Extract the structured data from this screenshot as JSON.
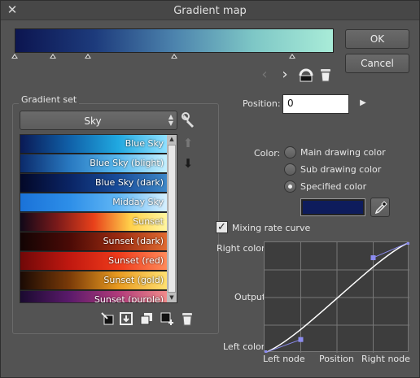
{
  "window": {
    "title": "Gradient map",
    "close_glyph": "✕"
  },
  "buttons": {
    "ok": "OK",
    "cancel": "Cancel"
  },
  "preview": {
    "gradient_colors": [
      "#0c1550",
      "#1d3b7c",
      "#4c83ad",
      "#7ec7c6",
      "#a9ecd8"
    ],
    "marker_positions": [
      0.0,
      0.12,
      0.23,
      0.5,
      0.87
    ]
  },
  "nav": {
    "prev": "‹",
    "next": "›"
  },
  "gradient_set": {
    "title": "Gradient set",
    "selected": "Sky",
    "items": [
      {
        "label": "Blue Sky",
        "colors": [
          "#0a1a55",
          "#1060a8",
          "#20a8e0",
          "#8fe0ff"
        ]
      },
      {
        "label": "Blue Sky (blight)",
        "colors": [
          "#0b2a6a",
          "#2878c0",
          "#58b8ee",
          "#c4f0ff"
        ]
      },
      {
        "label": "Blue Sky (dark)",
        "colors": [
          "#030828",
          "#0a2464",
          "#184c9a",
          "#3e88c8"
        ]
      },
      {
        "label": "Midday Sky",
        "colors": [
          "#1a72d8",
          "#2d8ee8",
          "#60b6f4",
          "#d6f0ff"
        ]
      },
      {
        "label": "Sunset",
        "colors": [
          "#100818",
          "#7a1a1a",
          "#e8401a",
          "#ffd04a",
          "#fff6a0"
        ]
      },
      {
        "label": "Sunset (dark)",
        "colors": [
          "#120404",
          "#4a0a06",
          "#9a2a10",
          "#e06a30"
        ]
      },
      {
        "label": "Sunset (red)",
        "colors": [
          "#700808",
          "#c01810",
          "#ee3a1a",
          "#ff8a5a"
        ]
      },
      {
        "label": "Sunset (gold)",
        "colors": [
          "#1a0a04",
          "#7a3a08",
          "#e89a20",
          "#ffe070"
        ]
      },
      {
        "label": "Sunset (purple)",
        "colors": [
          "#1a0a30",
          "#5a1a6a",
          "#b03a7a",
          "#f08a8a"
        ]
      }
    ]
  },
  "position": {
    "label": "Position:",
    "value": "0"
  },
  "color": {
    "label": "Color:",
    "options": [
      "Main drawing color",
      "Sub drawing color",
      "Specified color"
    ],
    "selected_index": 2,
    "specified_color": "#0e1c5c"
  },
  "mixing_curve": {
    "label": "Mixing rate curve",
    "checked": true,
    "right_color": "Right color",
    "output": "Output",
    "left_color": "Left color",
    "left_node": "Left node",
    "position": "Position",
    "right_node": "Right node",
    "control_points": [
      [
        0,
        0
      ],
      [
        0.25,
        0.12
      ],
      [
        0.75,
        0.86
      ],
      [
        1,
        1
      ]
    ]
  },
  "icons": {
    "delete": "trash-icon",
    "settings": "wrench-icon",
    "move_up": "arrow-up-icon",
    "move_down": "arrow-down-icon"
  },
  "colors": {
    "accent_node": "#8c8cf0",
    "curve": "#ffffff"
  }
}
